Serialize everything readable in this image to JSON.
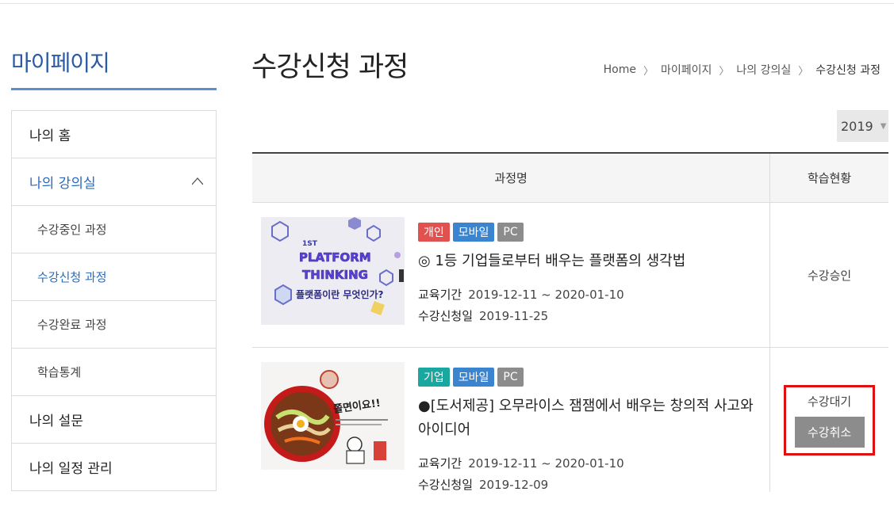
{
  "sidebar": {
    "title": "마이페이지",
    "items": [
      {
        "label": "나의 홈",
        "type": "main"
      },
      {
        "label": "나의 강의실",
        "type": "main-open"
      },
      {
        "label": "수강중인 과정",
        "type": "sub"
      },
      {
        "label": "수강신청 과정",
        "type": "sub-active"
      },
      {
        "label": "수강완료 과정",
        "type": "sub"
      },
      {
        "label": "학습통계",
        "type": "sub"
      },
      {
        "label": "나의 설문",
        "type": "main"
      },
      {
        "label": "나의 일정 관리",
        "type": "main"
      }
    ]
  },
  "header": {
    "title": "수강신청 과정",
    "breadcrumb": [
      "Home",
      "마이페이지",
      "나의 강의실",
      "수강신청 과정"
    ]
  },
  "year_select": {
    "value": "2019"
  },
  "table": {
    "headers": {
      "name": "과정명",
      "status": "학습현황"
    },
    "rows": [
      {
        "badges": [
          "개인",
          "모바일",
          "PC"
        ],
        "title": "◎ 1등 기업들로부터 배우는 플랫폼의 생각법",
        "period_label": "교육기간",
        "period": "2019-12-11 ~ 2020-01-10",
        "apply_label": "수강신청일",
        "apply_date": "2019-11-25",
        "status": "수강승인",
        "thumb_text": {
          "small": "1ST",
          "line1": "PLATFORM",
          "line2": "THINKING",
          "line3": "플랫폼이란 무엇인가?"
        }
      },
      {
        "badges": [
          "기업",
          "모바일",
          "PC"
        ],
        "title": "●[도서제공] 오무라이스 잼잼에서 배우는 창의적 사고와 아이디어",
        "period_label": "교육기간",
        "period": "2019-12-11 ~ 2020-01-10",
        "apply_label": "수강신청일",
        "apply_date": "2019-12-09",
        "status": "수강대기",
        "action": "수강취소",
        "thumb_text": {
          "line1": "쫄면이요!!"
        }
      }
    ]
  },
  "colors": {
    "accent": "#2a6bc0",
    "highlight": "#e01010"
  }
}
